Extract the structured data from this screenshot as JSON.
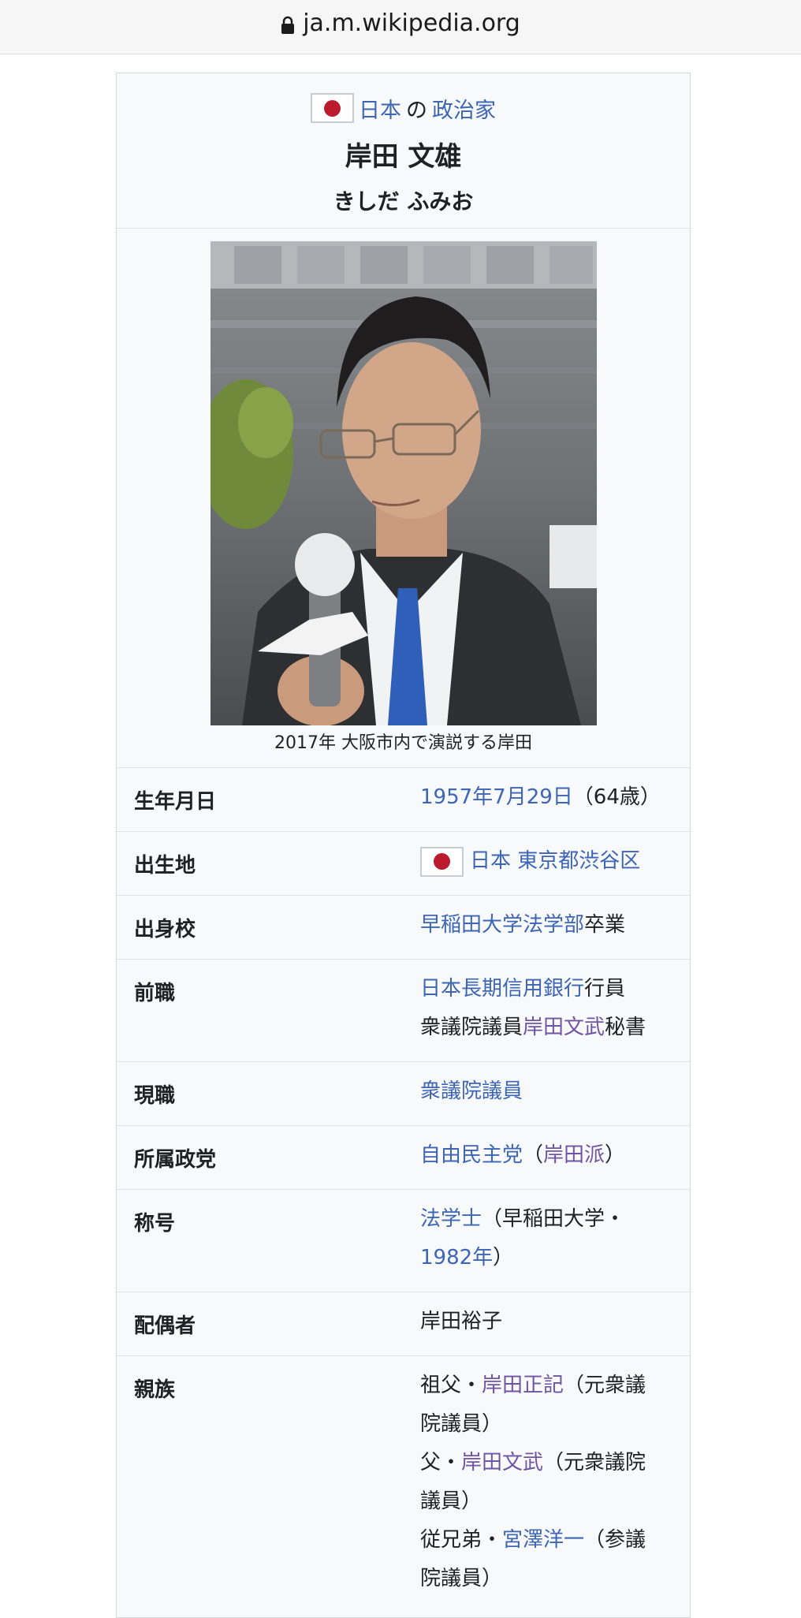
{
  "browser": {
    "url": "ja.m.wikipedia.org"
  },
  "infobox": {
    "category": {
      "country": "日本",
      "particle": "の",
      "role": "政治家"
    },
    "name": "岸田 文雄",
    "kana": "きしだ ふみお",
    "photo_caption": "2017年 大阪市内で演説する岸田",
    "rows": {
      "birthdate": {
        "label": "生年月日",
        "date_link": "1957年7月29日",
        "age": "（64歳）"
      },
      "birthplace": {
        "label": "出生地",
        "country_link": "日本",
        "place_link": "東京都渋谷区"
      },
      "school": {
        "label": "出身校",
        "school_link": "早稲田大学法学部",
        "suffix": "卒業"
      },
      "previous_job": {
        "label": "前職",
        "line1_link": "日本長期信用銀行",
        "line1_suffix": "行員",
        "line2_prefix": "衆議院議員",
        "line2_link": "岸田文武",
        "line2_suffix": "秘書"
      },
      "current_job": {
        "label": "現職",
        "link": "衆議院議員"
      },
      "party": {
        "label": "所属政党",
        "party_link": "自由民主党",
        "open": "（",
        "faction_link": "岸田派",
        "close": "）"
      },
      "degree": {
        "label": "称号",
        "degree_link": "法学士",
        "line1_rest": "（早稲田大学・",
        "year_link": "1982年",
        "close": "）"
      },
      "spouse": {
        "label": "配偶者",
        "value": "岸田裕子"
      },
      "relatives": {
        "label": "親族",
        "l1_prefix": "祖父・",
        "l1_link": "岸田正記",
        "l1_rest": "（元衆議",
        "l2": "院議員）",
        "l3_prefix": "父・",
        "l3_link": "岸田文武",
        "l3_rest": "（元衆議院",
        "l4": "議員）",
        "l5_prefix": "従兄弟・",
        "l5_link": "宮澤洋一",
        "l5_rest": "（参議",
        "l6": "院議員）"
      }
    }
  },
  "colors": {
    "link": "#3d65b5",
    "visited_link": "#6f54a3",
    "infobox_bg": "#f8f9fa",
    "flag_red": "#bc1a2e"
  }
}
